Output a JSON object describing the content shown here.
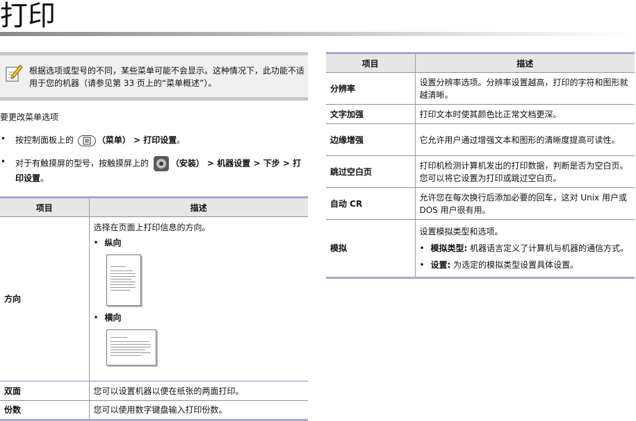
{
  "page": {
    "title": "打印"
  },
  "note": {
    "text": "根据选项或型号的不同，某些菜单可能不会显示。这种情况下，此功能不适用于您的机器（请参见第 33 页上的“菜单概述”）。"
  },
  "intro": "要更改菜单选项",
  "bullets": {
    "b1": {
      "pre": "按控制面板上的",
      "menu_label": "（菜单）",
      "sep1": " > ",
      "path": "打印设置",
      "end": "。"
    },
    "b2": {
      "pre": "对于有触摸屏的型号，按触摸屏上的",
      "install_label": "（安装）",
      "sep1": " > ",
      "machine": "机器设置",
      "sep2": " > ",
      "next": "下步",
      "sep3": " > ",
      "path": "打印设置",
      "end": "。"
    }
  },
  "table_left": {
    "headers": [
      "项目",
      "描述"
    ],
    "orientation": {
      "item": "方向",
      "desc": "选择在页面上打印信息的方向。",
      "portrait": "纵向",
      "landscape": "横向"
    },
    "duplex": {
      "item": "双面",
      "desc": "您可以设置机器以便在纸张的两面打印。"
    },
    "copies": {
      "item": "份数",
      "desc": "您可以使用数字键盘输入打印份数。"
    }
  },
  "table_right": {
    "headers": [
      "项目",
      "描述"
    ],
    "resolution": {
      "item": "分辨率",
      "desc": "设置分辨率选项。分辨率设置越高，打印的字符和图形就越清晰。"
    },
    "darken": {
      "item": "文字加强",
      "desc": "打印文本时使其颜色比正常文档更深。"
    },
    "edge": {
      "item": "边缘增强",
      "desc": "它允许用户通过增强文本和图形的清晰度提高可读性。"
    },
    "skip": {
      "item": "跳过空白页",
      "desc": "打印机检测计算机发出的打印数据，判断是否为空白页。您可以将它设置为打印或跳过空白页。"
    },
    "autocr": {
      "item": "自动 CR",
      "desc": "允许您在每次换行后添加必要的回车，这对 Unix 用户或 DOS 用户很有用。"
    },
    "emulation": {
      "item": "模拟",
      "desc": "设置模拟类型和选项。",
      "type_label": "模拟类型:",
      "type_text": " 机器语言定义了计算机与机器的通信方式。",
      "setup_label": "设置:",
      "setup_text": " 为选定的模拟类型设置具体设置。"
    }
  }
}
